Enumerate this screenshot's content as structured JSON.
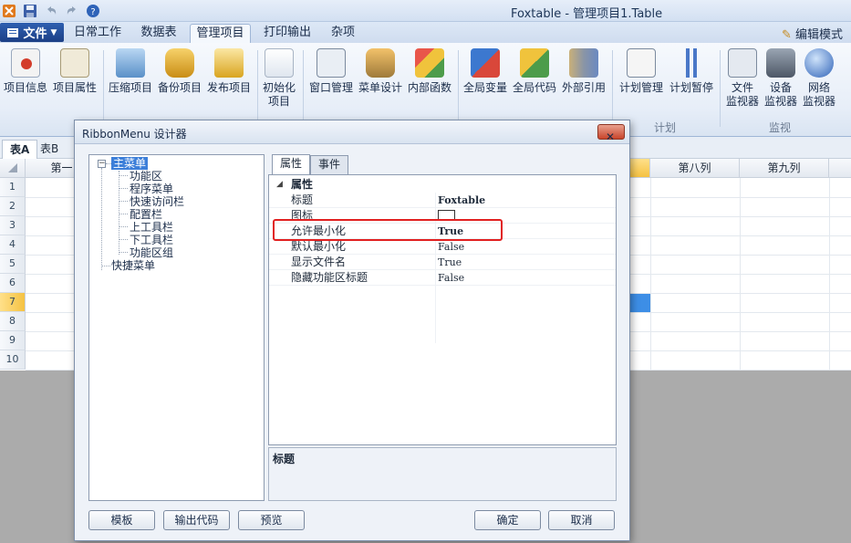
{
  "window": {
    "title": "Foxtable - 管理项目1.Table"
  },
  "menu": {
    "file_label": "文件",
    "tabs": [
      "日常工作",
      "数据表",
      "管理项目",
      "打印输出",
      "杂项"
    ],
    "active_tab": "管理项目",
    "edit_mode_label": "编辑模式"
  },
  "ribbon": {
    "buttons": [
      {
        "label": "项目信息",
        "icon": "project-info-icon"
      },
      {
        "label": "项目属性",
        "icon": "project-properties-icon"
      },
      {
        "label": "压缩项目",
        "icon": "compress-project-icon"
      },
      {
        "label": "备份项目",
        "icon": "backup-project-icon"
      },
      {
        "label": "发布项目",
        "icon": "publish-project-icon"
      },
      {
        "label": "初始化",
        "label2": "项目",
        "icon": "initialize-project-icon"
      },
      {
        "label": "窗口管理",
        "icon": "window-manage-icon"
      },
      {
        "label": "菜单设计",
        "icon": "menu-design-icon"
      },
      {
        "label": "内部函数",
        "icon": "internal-function-icon"
      },
      {
        "label": "全局变量",
        "icon": "global-variable-icon"
      },
      {
        "label": "全局代码",
        "icon": "global-code-icon"
      },
      {
        "label": "外部引用",
        "icon": "external-reference-icon"
      },
      {
        "label": "计划管理",
        "icon": "schedule-manage-icon"
      },
      {
        "label": "计划暂停",
        "icon": "schedule-pause-icon"
      },
      {
        "label": "文件",
        "label2": "监视器",
        "icon": "file-monitor-icon"
      },
      {
        "label": "设备",
        "label2": "监视器",
        "icon": "device-monitor-icon"
      },
      {
        "label": "网络",
        "label2": "监视器",
        "icon": "network-monitor-icon"
      }
    ],
    "groups": {
      "schedule": "计划",
      "monitor": "监视"
    }
  },
  "sheet": {
    "tabs": [
      "表A",
      "表B"
    ],
    "columns": {
      "first": "第一",
      "eighth": "第八列",
      "ninth": "第九列"
    },
    "rows": [
      "1",
      "2",
      "3",
      "4",
      "5",
      "6",
      "7",
      "8",
      "9",
      "10"
    ]
  },
  "dialog": {
    "title": "RibbonMenu 设计器",
    "tree": {
      "root": "主菜单",
      "children": [
        "功能区",
        "程序菜单",
        "快速访问栏",
        "配置栏",
        "上工具栏",
        "下工具栏",
        "功能区组"
      ],
      "second_root": "快捷菜单"
    },
    "prop_tabs": [
      "属性",
      "事件"
    ],
    "category": "属性",
    "properties": [
      {
        "name": "标题",
        "value": "Foxtable"
      },
      {
        "name": "图标",
        "value": ""
      },
      {
        "name": "允许最小化",
        "value": "True"
      },
      {
        "name": "默认最小化",
        "value": "False"
      },
      {
        "name": "显示文件名",
        "value": "True"
      },
      {
        "name": "隐藏功能区标题",
        "value": "False"
      }
    ],
    "description_title": "标题",
    "buttons": {
      "template": "模板",
      "export_code": "输出代码",
      "preview": "预览",
      "ok": "确定",
      "cancel": "取消"
    },
    "highlight_color": "#e12020"
  }
}
